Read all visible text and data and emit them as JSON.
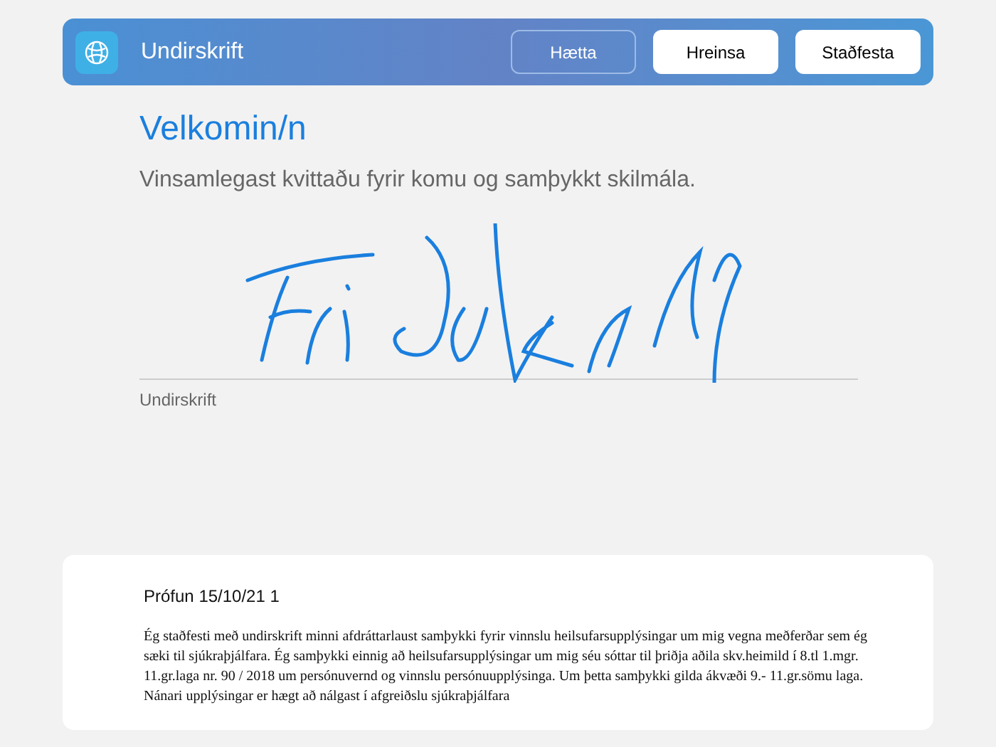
{
  "header": {
    "title": "Undirskrift",
    "buttons": [
      {
        "label": "Hætta",
        "kind": "outline"
      },
      {
        "label": "Hreinsa",
        "kind": "solid"
      },
      {
        "label": "Staðfesta",
        "kind": "solid"
      }
    ]
  },
  "welcome": "Velkomin/n",
  "instruction": "Vinsamlegast kvittaðu fyrir komu og samþykkt skilmála.",
  "signature": {
    "label": "Undirskrift"
  },
  "terms": {
    "title": "Prófun 15/10/21 1",
    "body": "Ég staðfesti með undirskrift minni afdráttarlaust samþykki fyrir vinnslu heilsufarsupplýsingar um mig vegna meðferðar sem ég sæki til sjúkraþjálfara. Ég samþykki einnig að heilsufarsupplýsingar um mig séu sóttar til þriðja aðila skv.heimild í 8.tl 1.mgr. 11.gr.laga nr. 90 / 2018 um persónuvernd og vinnslu persónuupplýsinga. Um þetta samþykki gilda ákvæði 9.- 11.gr.sömu laga. Nánari upplýsingar er hægt að nálgast í afgreiðslu sjúkraþjálfara"
  }
}
